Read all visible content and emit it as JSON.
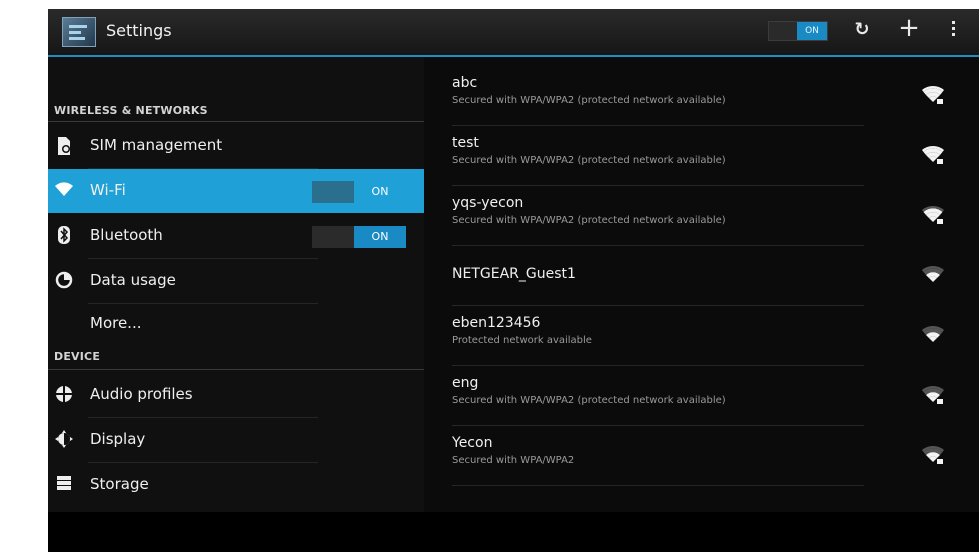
{
  "action_bar": {
    "title": "Settings",
    "app_icon": "settings-app-icon",
    "master_toggle": "ON",
    "icons": [
      "wps-refresh-icon",
      "add-icon",
      "overflow-menu-icon"
    ]
  },
  "sections": {
    "wireless": "WIRELESS & NETWORKS",
    "device": "DEVICE"
  },
  "nav": {
    "sim": {
      "label": "SIM management",
      "icon": "sim-icon"
    },
    "wifi": {
      "label": "Wi-Fi",
      "icon": "wifi-icon",
      "toggle": "ON"
    },
    "bluetooth": {
      "label": "Bluetooth",
      "icon": "bluetooth-icon",
      "toggle": "ON"
    },
    "data": {
      "label": "Data usage",
      "icon": "data-usage-icon"
    },
    "more": {
      "label": "More..."
    },
    "audio": {
      "label": "Audio profiles",
      "icon": "audio-profiles-icon"
    },
    "display": {
      "label": "Display",
      "icon": "display-icon"
    },
    "storage": {
      "label": "Storage",
      "icon": "storage-icon"
    }
  },
  "networks": [
    {
      "name": "abc",
      "status": "Secured with WPA/WPA2 (protected network available)",
      "signal_bars": 4,
      "secured": true
    },
    {
      "name": "test",
      "status": "Secured with WPA/WPA2 (protected network available)",
      "signal_bars": 4,
      "secured": true
    },
    {
      "name": "yqs-yecon",
      "status": "Secured with WPA/WPA2 (protected network available)",
      "signal_bars": 3,
      "secured": true
    },
    {
      "name": "NETGEAR_Guest1",
      "status": "",
      "signal_bars": 2,
      "secured": false
    },
    {
      "name": "eben123456",
      "status": "Protected network available",
      "signal_bars": 2,
      "secured": false
    },
    {
      "name": "eng",
      "status": "Secured with WPA/WPA2 (protected network available)",
      "signal_bars": 2,
      "secured": true
    },
    {
      "name": "Yecon",
      "status": "Secured with WPA/WPA2",
      "signal_bars": 2,
      "secured": true
    }
  ],
  "colors": {
    "accent": "#1fa0d6",
    "background": "#0b0b0b"
  }
}
